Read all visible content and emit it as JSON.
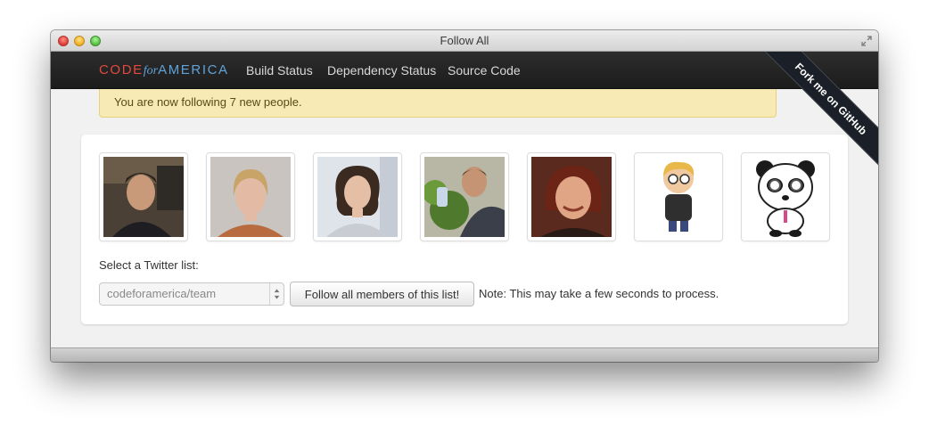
{
  "window": {
    "title": "Follow All"
  },
  "navbar": {
    "brand": {
      "code": "CODE",
      "for": "for",
      "america": "AMERICA"
    },
    "links": [
      "Build Status",
      "Dependency Status",
      "Source Code"
    ]
  },
  "ribbon": {
    "label": "Fork me on GitHub"
  },
  "alert": {
    "message": "You are now following 7 new people."
  },
  "avatars": [
    {
      "name": "avatar-1"
    },
    {
      "name": "avatar-2"
    },
    {
      "name": "avatar-3"
    },
    {
      "name": "avatar-4"
    },
    {
      "name": "avatar-5"
    },
    {
      "name": "avatar-6"
    },
    {
      "name": "avatar-7"
    }
  ],
  "form": {
    "label": "Select a Twitter list:",
    "selected": "codeforamerica/team",
    "button": "Follow all members of this list!",
    "note": "Note: This may take a few seconds to process."
  },
  "colors": {
    "brand_red": "#e04a3c",
    "brand_blue": "#5fa3d8",
    "alert_bg": "#f7eab4",
    "navbar_bg": "#222222"
  }
}
